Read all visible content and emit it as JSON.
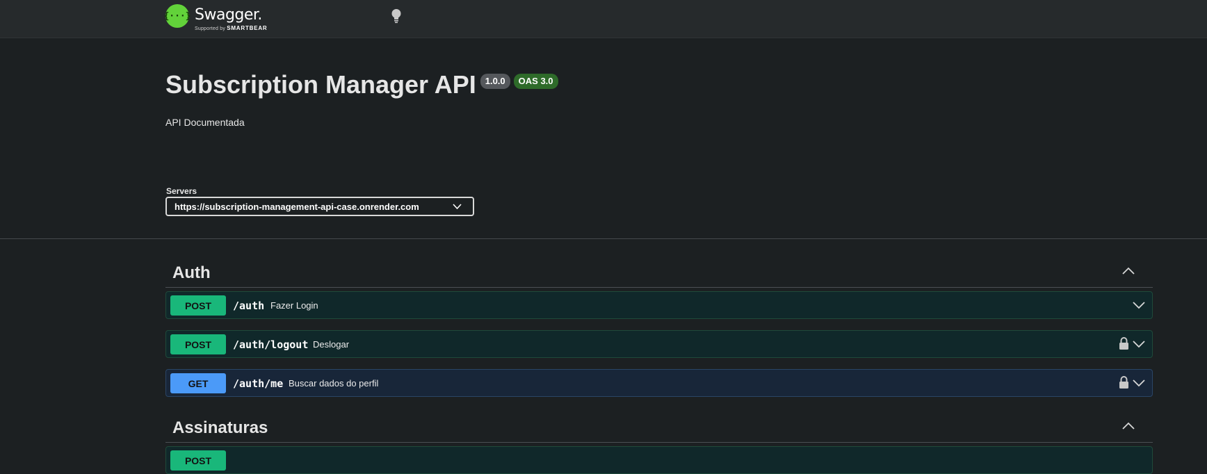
{
  "topbar": {
    "logo_text": "{···}",
    "brand": "Swagger.",
    "supported_by": "Supported by",
    "smartbear": "SMARTBEAR",
    "theme_icon": "lightbulb-icon"
  },
  "info": {
    "title": "Subscription Manager API",
    "version": "1.0.0",
    "oas": "OAS 3.0",
    "description": "API Documentada"
  },
  "servers": {
    "label": "Servers",
    "selected": "https://subscription-management-api-case.onrender.com"
  },
  "colors": {
    "post": "#19b77a",
    "get": "#4b9af8",
    "background": "#1c2022"
  },
  "sections": [
    {
      "name": "Auth",
      "operations": [
        {
          "method": "POST",
          "path": "/auth",
          "summary": "Fazer Login"
        },
        {
          "method": "POST",
          "path": "/auth/logout",
          "summary": "Deslogar"
        },
        {
          "method": "GET",
          "path": "/auth/me",
          "summary": "Buscar dados do perfil"
        }
      ]
    },
    {
      "name": "Assinaturas",
      "operations": [
        {
          "method": "POST",
          "path": "",
          "summary": ""
        }
      ]
    }
  ]
}
